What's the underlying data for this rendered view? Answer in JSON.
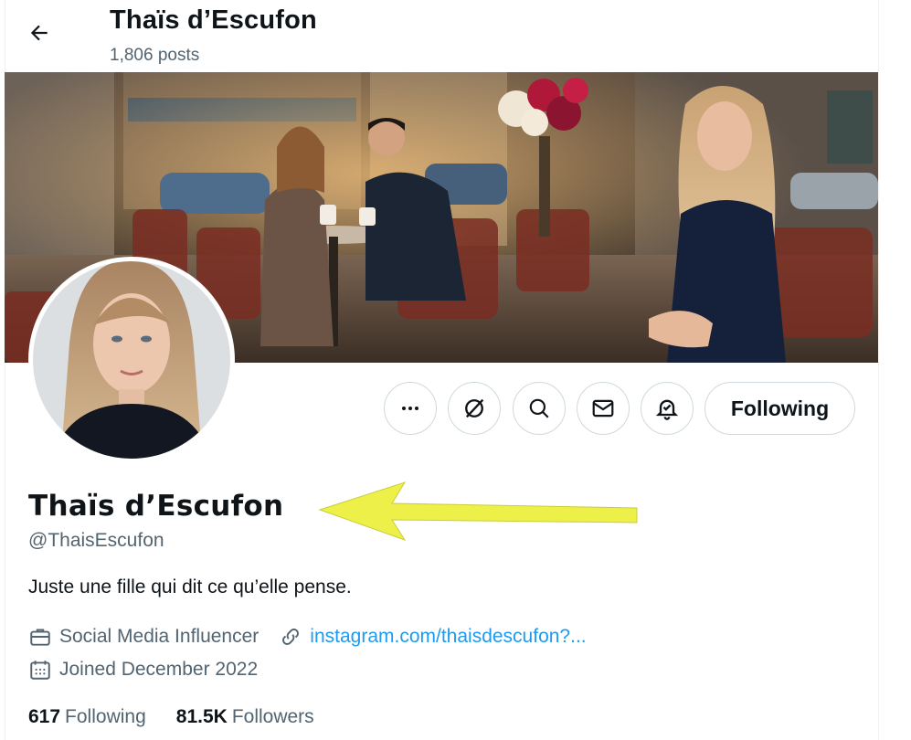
{
  "header": {
    "title": "Thaïs d’Escufon",
    "posts_count": "1,806 posts"
  },
  "profile": {
    "display_name": "Thaïs d’Escufon",
    "handle": "@ThaisEscufon",
    "bio": "Juste une fille qui dit ce qu’elle pense.",
    "category": "Social Media Influencer",
    "website": "instagram.com/thaisdescufon?...",
    "joined": "Joined December 2022"
  },
  "actions": {
    "more": "more-icon",
    "grok": "grok-icon",
    "search": "search-icon",
    "message": "mail-icon",
    "notify": "bell-icon",
    "following_label": "Following"
  },
  "stats": {
    "following_count": "617",
    "following_label": "Following",
    "followers_count": "81.5K",
    "followers_label": "Followers"
  },
  "colors": {
    "link": "#1d9bf0",
    "secondary_text": "#536471",
    "primary_text": "#0f1419",
    "border": "#cfd9de",
    "annotation_arrow": "#eef04a"
  }
}
